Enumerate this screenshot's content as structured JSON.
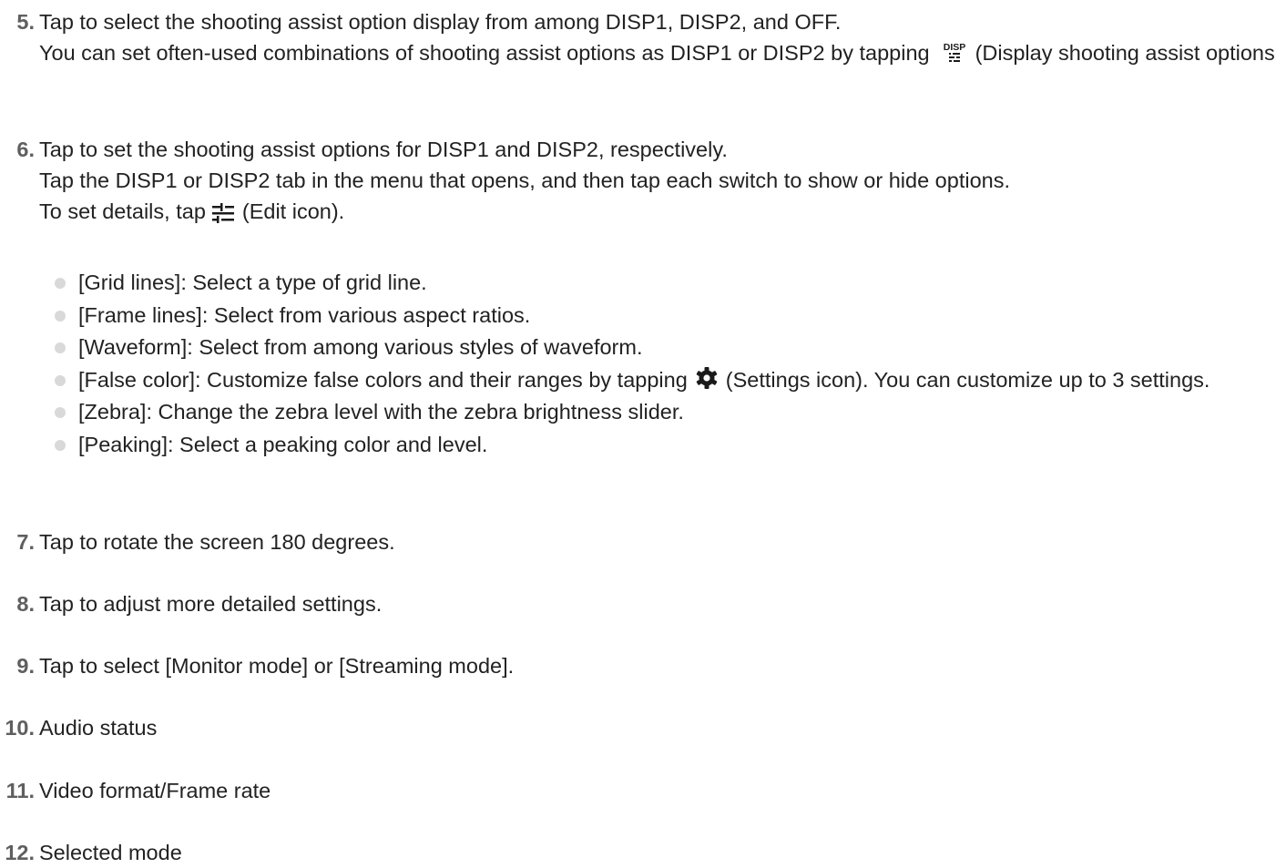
{
  "items": [
    {
      "number": "5.",
      "lines": [
        "Tap to select the shooting assist option display from among DISP1, DISP2, and OFF.",
        "You can set often-used combinations of shooting assist options as DISP1 or DISP2 by tapping",
        "(Display shooting assist options icon)."
      ],
      "icon": "disp-icon",
      "icon_label": "DISP"
    },
    {
      "number": "6.",
      "lines": [
        "Tap to set the shooting assist options for DISP1 and DISP2, respectively.",
        "Tap the DISP1 or DISP2 tab in the menu that opens, and then tap each switch to show or hide options.",
        "To set details, tap",
        "(Edit icon)."
      ],
      "icon": "edit-icon",
      "bullets": [
        "[Grid lines]: Select a type of grid line.",
        "[Frame lines]: Select from various aspect ratios.",
        "[Waveform]: Select from among various styles of waveform.",
        "[False color]: Customize false colors and their ranges by tapping",
        "(Settings icon). You can customize up to 3 settings.",
        "[Zebra]: Change the zebra level with the zebra brightness slider.",
        "[Peaking]: Select a peaking color and level."
      ],
      "bullet_icon": "gear-icon"
    },
    {
      "number": "7.",
      "text": "Tap to rotate the screen 180 degrees."
    },
    {
      "number": "8.",
      "text": "Tap to adjust more detailed settings."
    },
    {
      "number": "9.",
      "text": "Tap to select [Monitor mode] or [Streaming mode]."
    },
    {
      "number": "10.",
      "text": "Audio status"
    },
    {
      "number": "11.",
      "text": "Video format/Frame rate"
    },
    {
      "number": "12.",
      "text": "Selected mode"
    }
  ],
  "colors": {
    "text": "#222222",
    "number": "#5f5f5f",
    "bullet_dot": "#d9d9d9",
    "icon": "#1a1a1a"
  }
}
